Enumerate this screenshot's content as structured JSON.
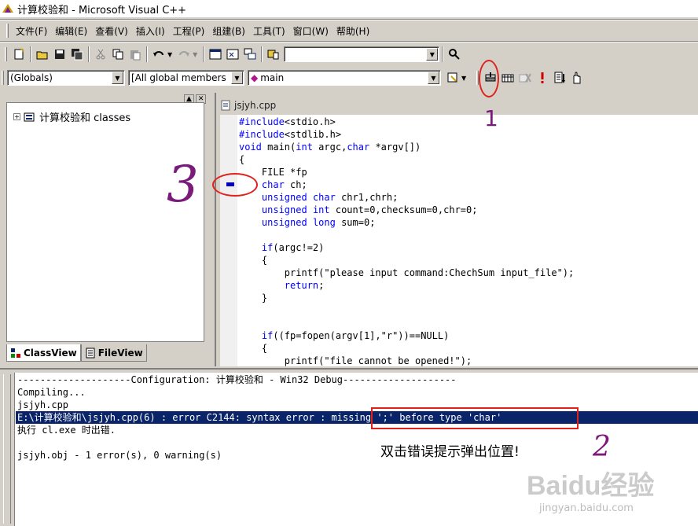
{
  "window": {
    "title": "计算校验和 - Microsoft Visual C++"
  },
  "menu": {
    "items": [
      "文件(F)",
      "编辑(E)",
      "查看(V)",
      "插入(I)",
      "工程(P)",
      "组建(B)",
      "工具(T)",
      "窗口(W)",
      "帮助(H)"
    ]
  },
  "wizard_bar": {
    "scope": "(Globals)",
    "members": "[All global members",
    "function": "main"
  },
  "workspace": {
    "tree_root": "计算校验和 classes",
    "tabs": [
      "ClassView",
      "FileView"
    ]
  },
  "editor": {
    "tab_label": "jsjyh.cpp",
    "lines": [
      [
        {
          "t": "#include",
          "k": 1
        },
        {
          "t": "<stdio.h>"
        }
      ],
      [
        {
          "t": "#include",
          "k": 1
        },
        {
          "t": "<stdlib.h>"
        }
      ],
      [
        {
          "t": "void",
          "k": 1
        },
        {
          "t": " main("
        },
        {
          "t": "int",
          "k": 1
        },
        {
          "t": " argc,"
        },
        {
          "t": "char",
          "k": 1
        },
        {
          "t": " *argv[])"
        }
      ],
      [
        {
          "t": "{"
        }
      ],
      [
        {
          "t": "    FILE *fp"
        }
      ],
      [
        {
          "t": "    "
        },
        {
          "t": "char",
          "k": 1
        },
        {
          "t": " ch;"
        }
      ],
      [
        {
          "t": "    "
        },
        {
          "t": "unsigned",
          "k": 1
        },
        {
          "t": " "
        },
        {
          "t": "char",
          "k": 1
        },
        {
          "t": " chr1,chrh;"
        }
      ],
      [
        {
          "t": "    "
        },
        {
          "t": "unsigned",
          "k": 1
        },
        {
          "t": " "
        },
        {
          "t": "int",
          "k": 1
        },
        {
          "t": " count=0,checksum=0,chr=0;"
        }
      ],
      [
        {
          "t": "    "
        },
        {
          "t": "unsigned",
          "k": 1
        },
        {
          "t": " "
        },
        {
          "t": "long",
          "k": 1
        },
        {
          "t": " sum=0;"
        }
      ],
      [
        {
          "t": ""
        }
      ],
      [
        {
          "t": "    "
        },
        {
          "t": "if",
          "k": 1
        },
        {
          "t": "(argc!=2)"
        }
      ],
      [
        {
          "t": "    {"
        }
      ],
      [
        {
          "t": "        printf(\"please input command:ChechSum input_file\");"
        }
      ],
      [
        {
          "t": "        "
        },
        {
          "t": "return",
          "k": 1
        },
        {
          "t": ";"
        }
      ],
      [
        {
          "t": "    }"
        }
      ],
      [
        {
          "t": ""
        }
      ],
      [
        {
          "t": ""
        }
      ],
      [
        {
          "t": "    "
        },
        {
          "t": "if",
          "k": 1
        },
        {
          "t": "((fp=fopen(argv[1],\"r\"))==NULL)"
        }
      ],
      [
        {
          "t": "    {"
        }
      ],
      [
        {
          "t": "        printf(\"file cannot be opened!\");"
        }
      ]
    ]
  },
  "output": {
    "lines": [
      "--------------------Configuration: 计算校验和 - Win32 Debug--------------------",
      "Compiling...",
      "jsjyh.cpp",
      "E:\\计算校验和\\jsjyh.cpp(6) : error C2144: syntax error : missing ';' before type 'char'",
      "执行 cl.exe 时出错.",
      "",
      "jsjyh.obj - 1 error(s), 0 warning(s)"
    ],
    "selected_index": 3
  },
  "annotations": {
    "note": "双击错误提示弹出位置!",
    "marks": [
      "1",
      "2",
      "3"
    ],
    "color": "#e0221c",
    "ink_color": "#7a1a7a"
  },
  "watermark": {
    "brand": "Baidu经验",
    "url": "jingyan.baidu.com"
  },
  "icons": [
    "app-icon",
    "new-file-icon",
    "open-icon",
    "save-icon",
    "save-all-icon",
    "cut-icon",
    "copy-icon",
    "paste-icon",
    "undo-icon",
    "redo-icon",
    "workspace-icon",
    "output-icon",
    "window-list-icon",
    "find-in-files-icon",
    "search-icon",
    "compile-icon",
    "build-icon",
    "stop-build-icon",
    "execute-icon",
    "go-icon",
    "breakpoint-icon",
    "error-marker-icon"
  ]
}
